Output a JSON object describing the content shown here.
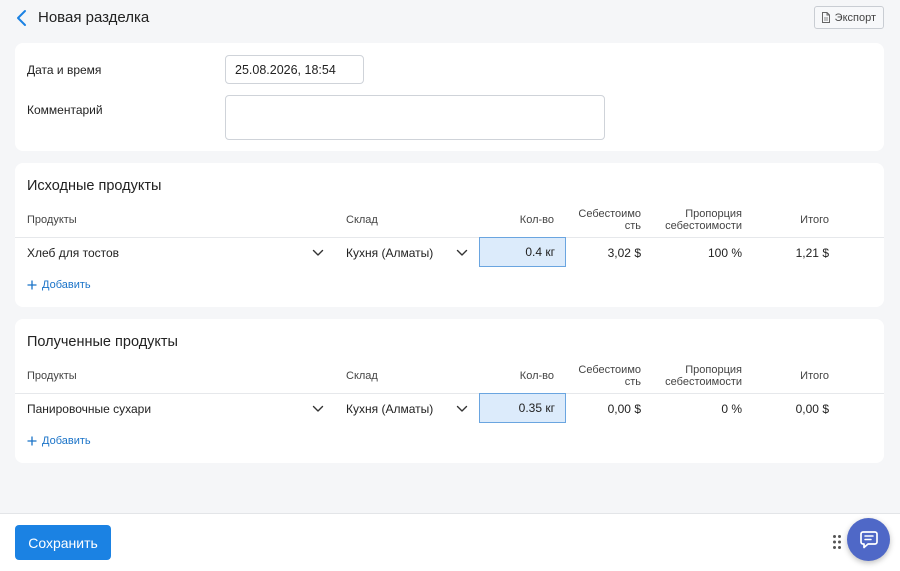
{
  "header": {
    "title": "Новая разделка",
    "export_label": "Экспорт"
  },
  "info": {
    "date_label": "Дата и время",
    "date_value": "25.08.2026, 18:54",
    "comment_label": "Комментарий",
    "comment_value": ""
  },
  "columns": {
    "product": "Продукты",
    "warehouse": "Склад",
    "qty": "Кол-во",
    "cost_line1": "Себестоимо",
    "cost_line2": "сть",
    "prop_line1": "Пропорция",
    "prop_line2": "себестоимости",
    "total": "Итого"
  },
  "source": {
    "title": "Исходные продукты",
    "rows": [
      {
        "product": "Хлеб для тостов",
        "warehouse": "Кухня (Алматы)",
        "qty": "0.4 кг",
        "cost": "3,02 $",
        "proportion": "100 %",
        "total": "1,21 $"
      }
    ],
    "add_label": "Добавить"
  },
  "result": {
    "title": "Полученные продукты",
    "rows": [
      {
        "product": "Панировочные сухари",
        "warehouse": "Кухня (Алматы)",
        "qty": "0.35 кг",
        "cost": "0,00 $",
        "proportion": "0 %",
        "total": "0,00 $"
      }
    ],
    "add_label": "Добавить"
  },
  "footer": {
    "save_label": "Сохранить"
  },
  "icons": {
    "back": "chevron-left-icon",
    "export": "document-icon",
    "dropdown": "chevron-down-icon",
    "add": "plus-icon",
    "drag": "drag-handle-icon",
    "chat": "chat-icon"
  },
  "colors": {
    "accent": "#1b82e3",
    "link": "#1a73c8",
    "qty_bg": "#dcebfb",
    "qty_border": "#6aa5e0",
    "chat_bg": "#4f68c7"
  }
}
